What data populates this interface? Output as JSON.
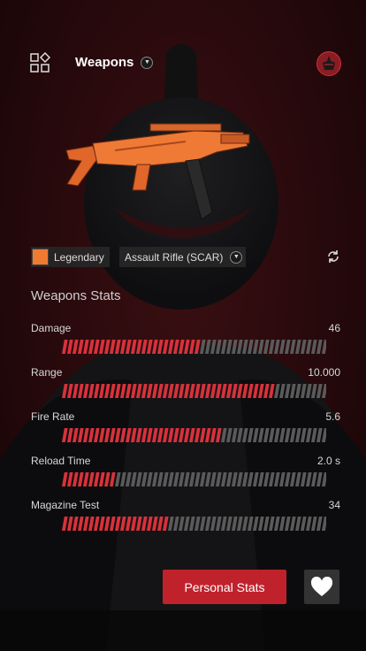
{
  "header": {
    "title": "Weapons"
  },
  "weapon": {
    "rarity": "Legendary",
    "type": "Assault Rifle (SCAR)"
  },
  "stats_section": {
    "title": "Weapons Stats",
    "stats": [
      {
        "label": "Damage",
        "value": "46",
        "fill": 0.52
      },
      {
        "label": "Range",
        "value": "10.000",
        "fill": 0.8
      },
      {
        "label": "Fire Rate",
        "value": "5.6",
        "fill": 0.6
      },
      {
        "label": "Reload Time",
        "value": "2.0 s",
        "fill": 0.2
      },
      {
        "label": "Magazine Test",
        "value": "34",
        "fill": 0.4
      }
    ]
  },
  "actions": {
    "personal_stats": "Personal Stats"
  },
  "icons": {
    "apps": "apps-icon",
    "dropdown": "chevron-down-icon",
    "refresh": "refresh-icon",
    "favorite": "heart-icon",
    "avatar": "avatar"
  },
  "colors": {
    "accent": "#c0222c",
    "bar_filled": "#d9313b",
    "bar_empty": "#5a5a5a",
    "legendary": "#f07a30",
    "background": "#2a0a0d"
  }
}
